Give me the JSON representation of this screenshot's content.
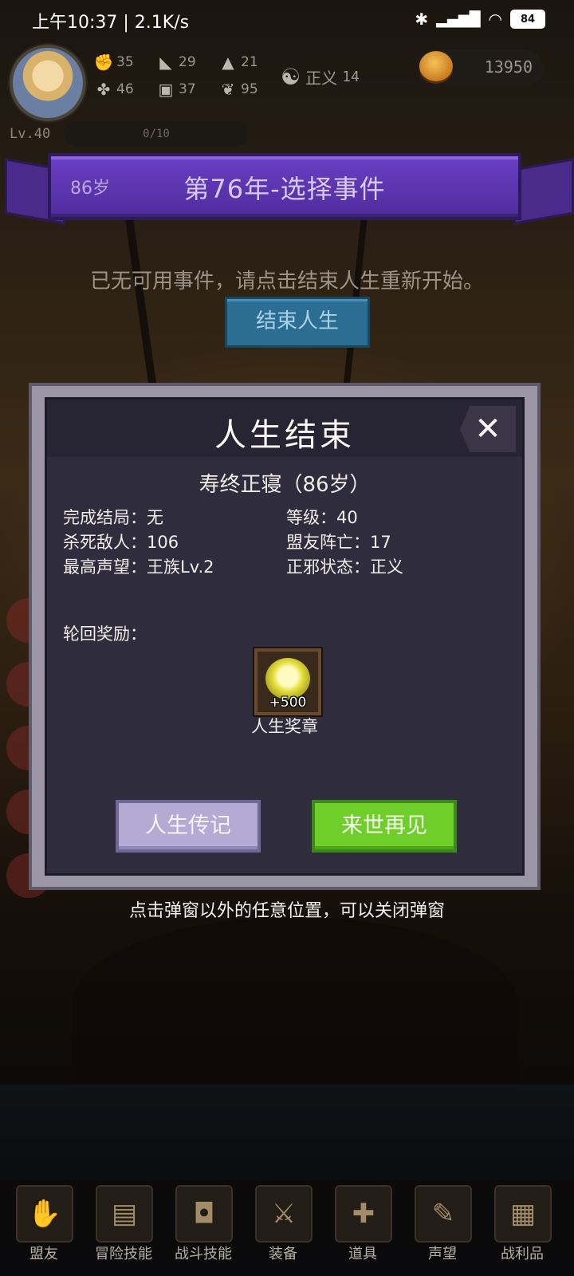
{
  "status_bar": {
    "time_speed": "上午10:37 | 2.1K/s",
    "battery": "84"
  },
  "player": {
    "stats": [
      {
        "icon": "fist-icon",
        "value": "35"
      },
      {
        "icon": "clover-icon",
        "value": "46"
      },
      {
        "icon": "boot-icon",
        "value": "29"
      },
      {
        "icon": "armor-icon",
        "value": "37"
      },
      {
        "icon": "wizard-hat-icon",
        "value": "21"
      },
      {
        "icon": "wings-icon",
        "value": "95"
      }
    ],
    "alignment_label": "正义",
    "alignment_value": "14",
    "gold": "13950",
    "level": "Lv.40",
    "xp": "0/10"
  },
  "banner": {
    "age": "86岁",
    "title": "第76年-选择事件"
  },
  "event_area": {
    "message": "已无可用事件，请点击结束人生重新开始。",
    "end_life_button": "结束人生"
  },
  "modal": {
    "title": "人生结束",
    "subtitle": "寿终正寝（86岁）",
    "info": {
      "ending": "完成结局：无",
      "level": "等级：40",
      "kills": "杀死敌人：106",
      "ally_deaths": "盟友阵亡：17",
      "reputation": "最高声望：王族Lv.2",
      "alignment": "正邪状态：正义"
    },
    "reward_label": "轮回奖励：",
    "reward": {
      "icon": "medal-icon",
      "count": "+500",
      "name": "人生奖章"
    },
    "biography_button": "人生传记",
    "next_life_button": "来世再见"
  },
  "hint": "点击弹窗以外的任意位置，可以关闭弹窗",
  "nav": [
    {
      "label": "盟友",
      "icon": "handshake-icon"
    },
    {
      "label": "冒险技能",
      "icon": "book-icon"
    },
    {
      "label": "战斗技能",
      "icon": "backpack-icon"
    },
    {
      "label": "装备",
      "icon": "swords-icon"
    },
    {
      "label": "道具",
      "icon": "amulet-icon"
    },
    {
      "label": "声望",
      "icon": "scroll-icon"
    },
    {
      "label": "战利品",
      "icon": "chest-icon"
    }
  ],
  "colors": {
    "banner_purple": "#5a34b0",
    "confirm_green": "#6fce2a",
    "biography_lavender": "#b3abd3",
    "end_life_blue": "#2c6e93"
  }
}
